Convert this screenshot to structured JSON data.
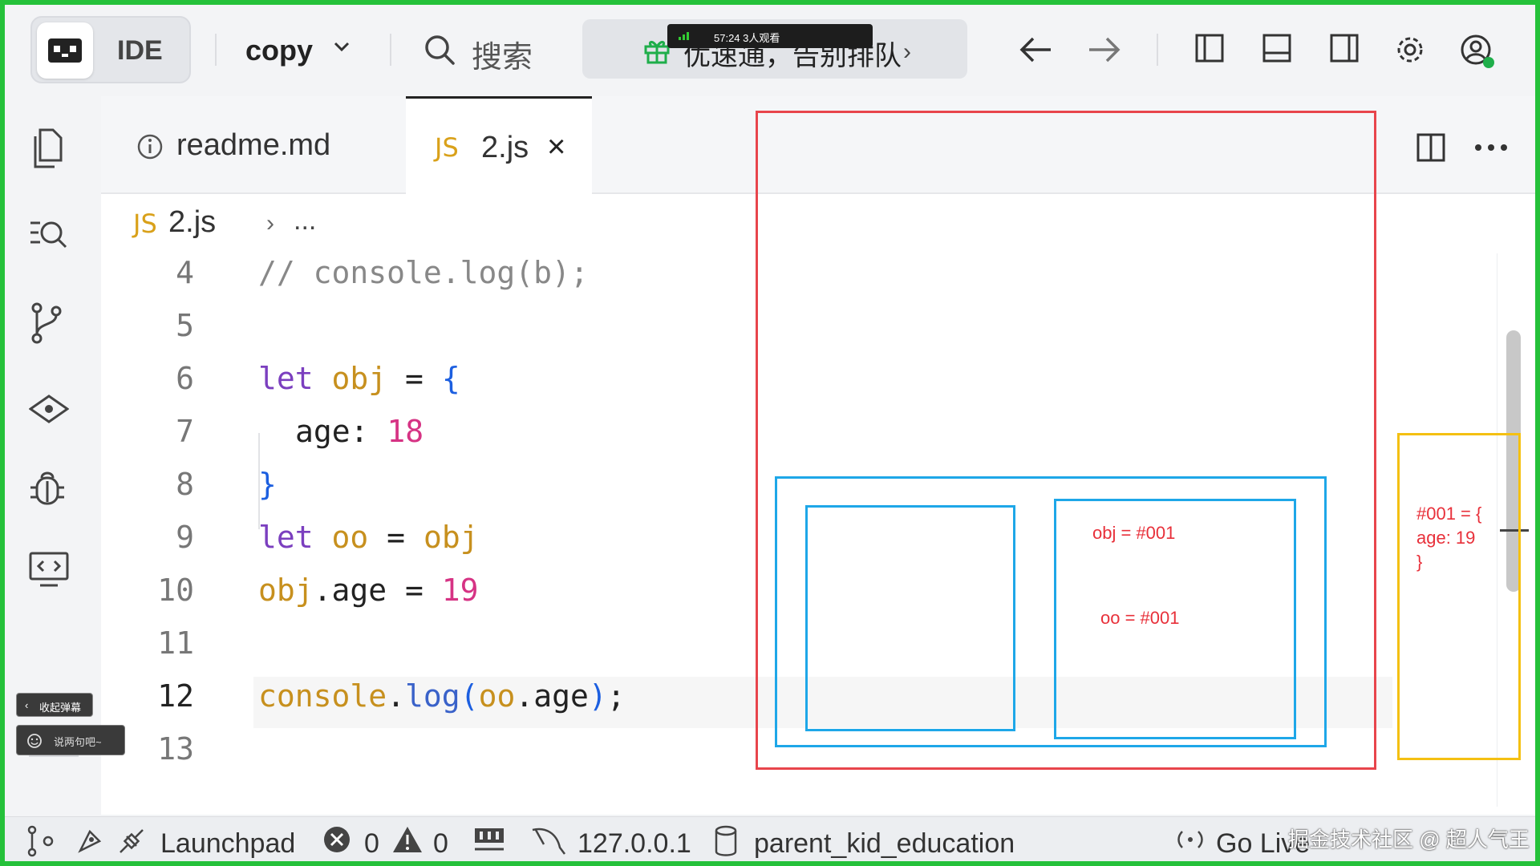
{
  "topbar": {
    "ide_label": "IDE",
    "project_name": "copy",
    "search_label": "搜索",
    "promo_text": "优速通，告别排队",
    "live_overlay": "57:24  3人观看"
  },
  "tabs": [
    {
      "label": "readme.md",
      "active": false
    },
    {
      "label": "2.js",
      "badge": "JS",
      "active": true
    }
  ],
  "breadcrumb": {
    "badge": "JS",
    "file": "2.js",
    "more": "..."
  },
  "code": {
    "lines": [
      {
        "n": "4"
      },
      {
        "n": "5"
      },
      {
        "n": "6"
      },
      {
        "n": "7"
      },
      {
        "n": "8"
      },
      {
        "n": "9"
      },
      {
        "n": "10"
      },
      {
        "n": "11"
      },
      {
        "n": "12"
      },
      {
        "n": "13"
      }
    ],
    "current_line": "12",
    "tokens": {
      "l4_comment": "// console.log(b);",
      "kw_let": "let",
      "obj": "obj",
      "eq": " = ",
      "open_brace": "{",
      "age_key": "age: ",
      "age_18": "18",
      "close_brace": "}",
      "oo": "oo",
      "dot_age": ".age",
      "age_19": "19",
      "console": "console",
      "dot": ".",
      "log": "log",
      "paren_open": "(",
      "paren_close": ")",
      "semi": ";"
    }
  },
  "annotations": {
    "stack_obj": "obj = #001",
    "stack_oo": "oo = #001",
    "heap_line1": "#001 = {",
    "heap_line2": "age: 19",
    "heap_line3": "}",
    "colors": {
      "outer": "#e8454c",
      "stack": "#1ea7e8",
      "heap": "#f4c012"
    }
  },
  "danmu": {
    "collapse_label": "收起弹幕",
    "input_placeholder": "说两句吧~"
  },
  "statusbar": {
    "launchpad": "Launchpad",
    "errors": "0",
    "warnings": "0",
    "host": "127.0.0.1",
    "database": "parent_kid_education",
    "go_live": "Go Live",
    "watermark": "掘金技术社区 @ 超人气王"
  }
}
